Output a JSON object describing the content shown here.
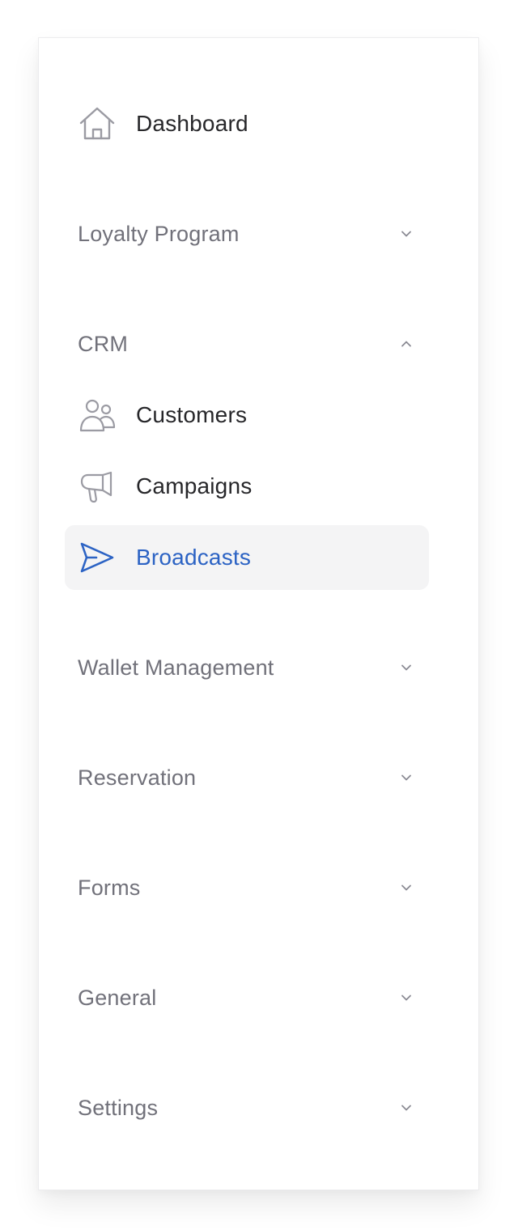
{
  "sidebar": {
    "dashboard": {
      "label": "Dashboard",
      "icon": "home-icon"
    },
    "sections": {
      "loyalty": {
        "label": "Loyalty Program",
        "expanded": false
      },
      "crm": {
        "label": "CRM",
        "expanded": true,
        "items": [
          {
            "label": "Customers",
            "icon": "users-icon",
            "active": false
          },
          {
            "label": "Campaigns",
            "icon": "megaphone-icon",
            "active": false
          },
          {
            "label": "Broadcasts",
            "icon": "send-icon",
            "active": true
          }
        ]
      },
      "wallet": {
        "label": "Wallet Management",
        "expanded": false
      },
      "reservation": {
        "label": "Reservation",
        "expanded": false
      },
      "forms": {
        "label": "Forms",
        "expanded": false
      },
      "general": {
        "label": "General",
        "expanded": false
      },
      "settings": {
        "label": "Settings",
        "expanded": false
      }
    }
  },
  "colors": {
    "active_text": "#2c63c4",
    "active_bg": "#f4f4f5",
    "section_text": "#71717a",
    "item_text": "#27272a",
    "icon_gray": "#9b9ba3"
  }
}
